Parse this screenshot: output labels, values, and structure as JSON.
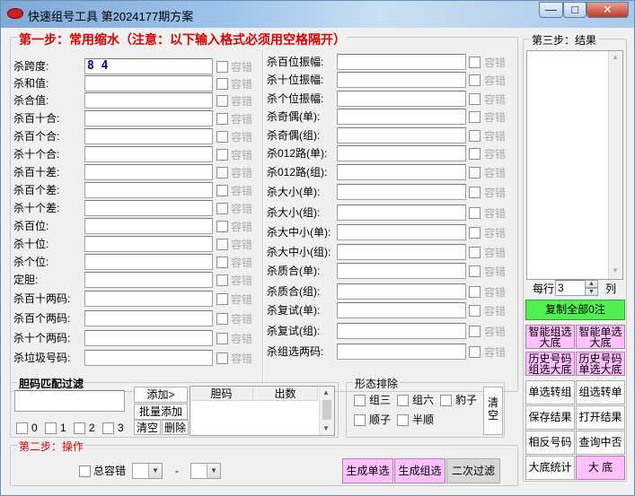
{
  "window": {
    "title": "快速组号工具   第2024177期方案",
    "minimize": "—",
    "maximize": "□",
    "close": "✕"
  },
  "step1": {
    "legend": "第一步：常用缩水（注意：以下输入格式必须用空格隔开）",
    "rongcuo": "容错",
    "left_fields": [
      {
        "label": "杀跨度:",
        "value": "8 4"
      },
      {
        "label": "杀和值:",
        "value": ""
      },
      {
        "label": "杀合值:",
        "value": ""
      },
      {
        "label": "杀百十合:",
        "value": ""
      },
      {
        "label": "杀百个合:",
        "value": ""
      },
      {
        "label": "杀十个合:",
        "value": ""
      },
      {
        "label": "杀百十差:",
        "value": ""
      },
      {
        "label": "杀百个差:",
        "value": ""
      },
      {
        "label": "杀十个差:",
        "value": ""
      },
      {
        "label": "杀百位:",
        "value": ""
      },
      {
        "label": "杀十位:",
        "value": ""
      },
      {
        "label": "杀个位:",
        "value": ""
      },
      {
        "label": "定胆:",
        "value": ""
      },
      {
        "label": "杀百十两码:",
        "value": ""
      },
      {
        "label": "杀百个两码:",
        "value": ""
      },
      {
        "label": "杀十个两码:",
        "value": ""
      },
      {
        "label": "杀垃圾号码:",
        "value": ""
      }
    ],
    "right_fields": [
      {
        "label": "杀百位振幅:",
        "value": ""
      },
      {
        "label": "杀十位振幅:",
        "value": ""
      },
      {
        "label": "杀个位振幅:",
        "value": ""
      },
      {
        "label": "杀奇偶(单):",
        "value": ""
      },
      {
        "label": "杀奇偶(组):",
        "value": ""
      },
      {
        "label": "杀012路(单):",
        "value": ""
      },
      {
        "label": "杀012路(组):",
        "value": ""
      },
      {
        "label": "杀大小(单):",
        "value": ""
      },
      {
        "label": "杀大小(组):",
        "value": ""
      },
      {
        "label": "杀大中小(单):",
        "value": ""
      },
      {
        "label": "杀大中小(组):",
        "value": ""
      },
      {
        "label": "杀质合(单):",
        "value": ""
      },
      {
        "label": "杀质合(组):",
        "value": ""
      },
      {
        "label": "杀复试(单):",
        "value": ""
      },
      {
        "label": "杀复试(组):",
        "value": ""
      },
      {
        "label": "杀组选两码:",
        "value": ""
      }
    ]
  },
  "danma": {
    "legend": "胆码匹配过滤",
    "add_button": "添加>",
    "batch_add_button": "批量添加",
    "clear_button": "清空",
    "delete_button": "删除",
    "col_danma": "胆码",
    "col_count": "出数",
    "checks": [
      "0",
      "1",
      "2",
      "3"
    ]
  },
  "xingtai": {
    "legend": "形态排除",
    "options": [
      "组三",
      "组六",
      "豹子",
      "顺子",
      "半顺"
    ],
    "clear_button": "清空"
  },
  "step2": {
    "legend": "第二步：操作",
    "total_rongcuo": "总容错",
    "dash": "-",
    "gen_single_button": "生成单选",
    "gen_group_button": "生成组选",
    "second_filter_button": "二次过滤"
  },
  "step3": {
    "legend": "第三步：结果",
    "per_row_label": "每行",
    "per_row_value": "3",
    "col_label": "列",
    "copy_all_button": "复制全部0注",
    "buttons": [
      [
        "智能组选\n大底",
        "智能单选\n大底"
      ],
      [
        "历史号码\n组选大底",
        "历史号码\n单选大底"
      ],
      [
        "单选转组",
        "组选转单"
      ],
      [
        "保存结果",
        "打开结果"
      ],
      [
        "相反号码",
        "查询中否"
      ],
      [
        "大底统计",
        "大  底"
      ]
    ]
  }
}
